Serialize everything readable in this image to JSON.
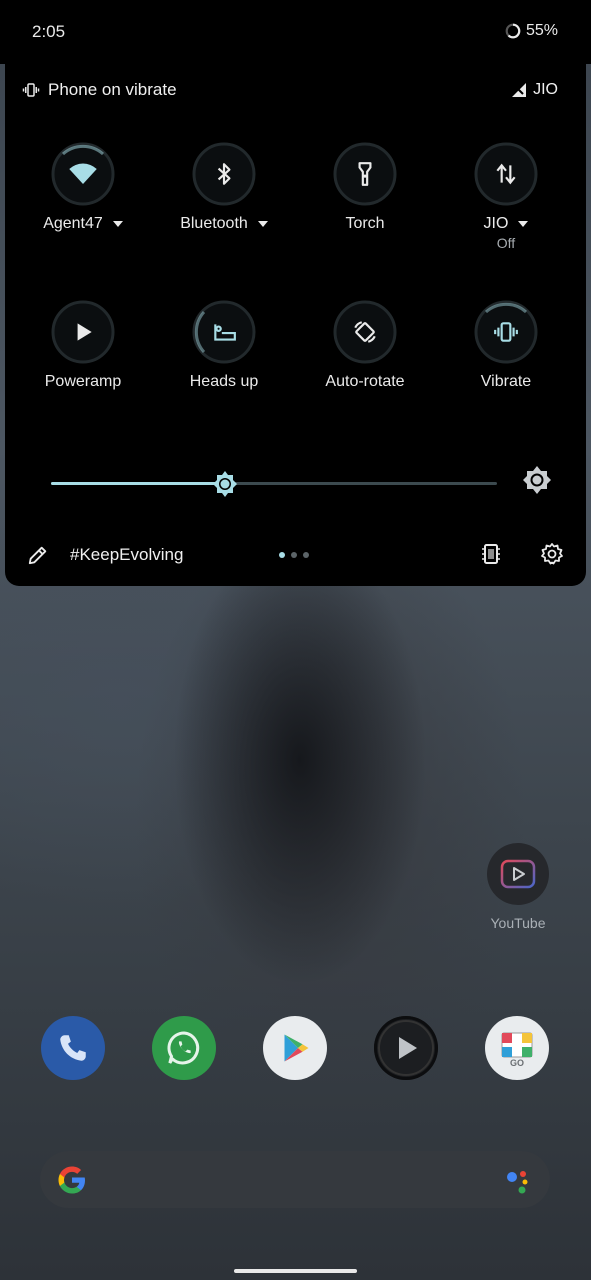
{
  "status_bar": {
    "time": "2:05",
    "battery": "55%"
  },
  "quick_settings": {
    "ringer_status": "Phone on vibrate",
    "carrier": "JIO",
    "accent_color": "#a8dde6",
    "tiles": [
      {
        "label": "Agent47",
        "icon": "wifi-icon",
        "has_menu": true,
        "active": true
      },
      {
        "label": "Bluetooth",
        "icon": "bluetooth-icon",
        "has_menu": true,
        "active": false
      },
      {
        "label": "Torch",
        "icon": "flashlight-icon",
        "has_menu": false,
        "active": false
      },
      {
        "label": "JIO",
        "sublabel": "Off",
        "icon": "mobile-data-icon",
        "has_menu": true,
        "active": false
      },
      {
        "label": "Poweramp",
        "icon": "play-icon",
        "has_menu": false,
        "active": false
      },
      {
        "label": "Heads up",
        "icon": "heads-up-icon",
        "has_menu": false,
        "active": false
      },
      {
        "label": "Auto-rotate",
        "icon": "rotate-icon",
        "has_menu": false,
        "active": false
      },
      {
        "label": "Vibrate",
        "icon": "vibrate-icon",
        "has_menu": false,
        "active": true
      }
    ],
    "brightness": 0.39,
    "footer_text": "#KeepEvolving",
    "page_count": 3,
    "current_page": 1
  },
  "home": {
    "youtube_label": "YouTube",
    "dock": [
      {
        "icon": "phone-icon",
        "color": "#2a5aa8"
      },
      {
        "icon": "whatsapp-icon",
        "color": "#2f9b4a"
      },
      {
        "icon": "play-store-icon",
        "color": "#e9ecee"
      },
      {
        "icon": "media-player-icon",
        "color": "#1c1e21"
      },
      {
        "icon": "gallery-go-icon",
        "color": "#e9ecee"
      }
    ],
    "gallery_badge": "GO"
  }
}
